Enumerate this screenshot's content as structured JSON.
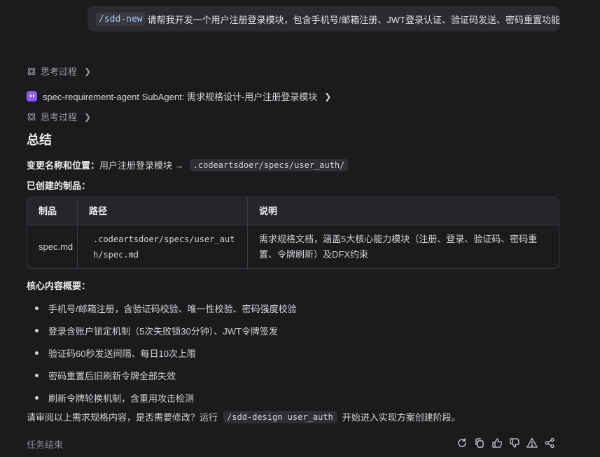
{
  "user_message": {
    "command": "/sdd-new",
    "text": "请帮我开发一个用户注册登录模块，包含手机号/邮箱注册、JWT登录认证、验证码发送、密码重置功能"
  },
  "thinking_1": {
    "label": "思考过程",
    "icon": "atom-icon"
  },
  "subagent": {
    "icon": "bot-icon",
    "label": "spec-requirement-agent SubAgent: 需求规格设计-用户注册登录模块"
  },
  "thinking_2": {
    "label": "思考过程",
    "icon": "atom-icon"
  },
  "summary": {
    "title": "总结",
    "change_label": "变更名称和位置：",
    "change_text": "用户注册登录模块 →",
    "change_path": ".codeartsdoer/specs/user_auth/",
    "artifacts_label": "已创建的制品：",
    "table": {
      "headers": [
        "制品",
        "路径",
        "说明"
      ],
      "rows": [
        {
          "artifact": "spec.md",
          "path": ".codeartsdoer/specs/user_auth/spec.md",
          "desc": "需求规格文档，涵盖5大核心能力模块（注册、登录、验证码、密码重置、令牌刷新）及DFX约束"
        }
      ]
    },
    "core_label": "核心内容概要：",
    "core_items": [
      "手机号/邮箱注册，含验证码校验、唯一性校验、密码强度校验",
      "登录含账户锁定机制（5次失败锁30分钟）、JWT令牌签发",
      "验证码60秒发送间隔、每日10次上限",
      "密码重置后旧刷新令牌全部失效",
      "刷新令牌轮换机制，含重用攻击检测"
    ],
    "closing_before": "请审阅以上需求规格内容，是否需要修改？运行",
    "closing_cmd": "/sdd-design user_auth",
    "closing_after": "开始进入实现方案创建阶段。"
  },
  "footer": {
    "status": "任务结束",
    "actions": [
      "refresh-icon",
      "copy-icon",
      "thumbs-up-icon",
      "thumbs-down-icon",
      "warning-icon",
      "share-icon"
    ]
  }
}
